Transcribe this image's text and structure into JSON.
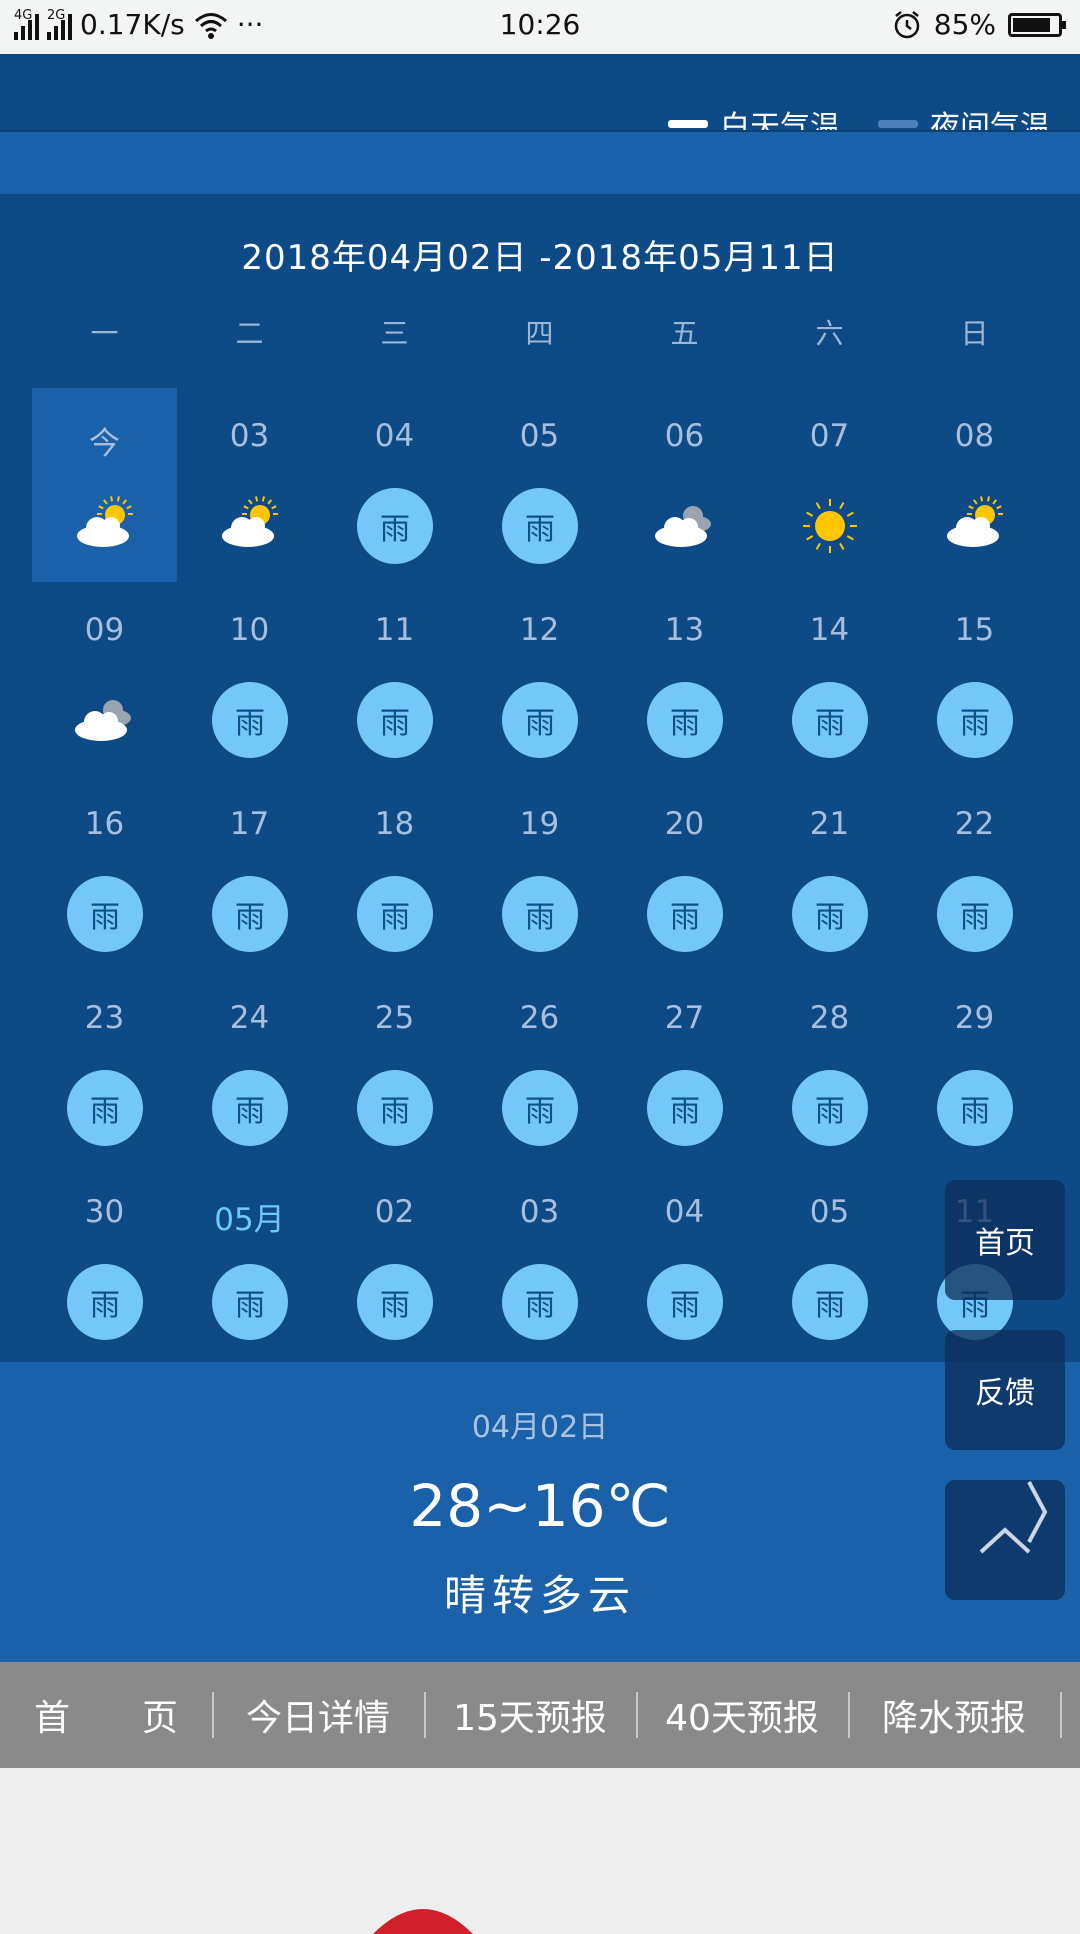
{
  "status_bar": {
    "net_4g": "4G",
    "net_2g": "2G",
    "speed": "0.17K/s",
    "more": "···",
    "time": "10:26",
    "battery": "85%",
    "battery_level": 0.85
  },
  "legend": {
    "day_label": "白天气温",
    "night_label": "夜间气温",
    "day_color": "#ffffff",
    "night_color": "#4d7fb8"
  },
  "calendar": {
    "range": "2018年04月02日 -2018年05月11日",
    "weekdays": [
      "一",
      "二",
      "三",
      "四",
      "五",
      "六",
      "日"
    ],
    "rain_label": "雨",
    "days": [
      {
        "label": "今",
        "icon": "partly-cloudy-icon"
      },
      {
        "label": "03",
        "icon": "partly-cloudy-icon"
      },
      {
        "label": "04",
        "icon": "rain-icon"
      },
      {
        "label": "05",
        "icon": "rain-icon"
      },
      {
        "label": "06",
        "icon": "cloudy-icon"
      },
      {
        "label": "07",
        "icon": "sunny-icon"
      },
      {
        "label": "08",
        "icon": "partly-cloudy-icon"
      },
      {
        "label": "09",
        "icon": "cloudy-icon"
      },
      {
        "label": "10",
        "icon": "rain-icon"
      },
      {
        "label": "11",
        "icon": "rain-icon"
      },
      {
        "label": "12",
        "icon": "rain-icon"
      },
      {
        "label": "13",
        "icon": "rain-icon"
      },
      {
        "label": "14",
        "icon": "rain-icon"
      },
      {
        "label": "15",
        "icon": "rain-icon"
      },
      {
        "label": "16",
        "icon": "rain-icon"
      },
      {
        "label": "17",
        "icon": "rain-icon"
      },
      {
        "label": "18",
        "icon": "rain-icon"
      },
      {
        "label": "19",
        "icon": "rain-icon"
      },
      {
        "label": "20",
        "icon": "rain-icon"
      },
      {
        "label": "21",
        "icon": "rain-icon"
      },
      {
        "label": "22",
        "icon": "rain-icon"
      },
      {
        "label": "23",
        "icon": "rain-icon"
      },
      {
        "label": "24",
        "icon": "rain-icon"
      },
      {
        "label": "25",
        "icon": "rain-icon"
      },
      {
        "label": "26",
        "icon": "rain-icon"
      },
      {
        "label": "27",
        "icon": "rain-icon"
      },
      {
        "label": "28",
        "icon": "rain-icon"
      },
      {
        "label": "29",
        "icon": "rain-icon"
      },
      {
        "label": "30",
        "icon": "rain-icon"
      },
      {
        "label": "05月",
        "icon": "rain-icon",
        "accent": true
      },
      {
        "label": "02",
        "icon": "rain-icon"
      },
      {
        "label": "03",
        "icon": "rain-icon"
      },
      {
        "label": "04",
        "icon": "rain-icon"
      },
      {
        "label": "05",
        "icon": "rain-icon"
      },
      {
        "label": "11",
        "icon": "rain-icon"
      }
    ]
  },
  "detail": {
    "date": "04月02日",
    "temp": "28~16℃",
    "condition": "晴转多云"
  },
  "float_buttons": {
    "home": "首页",
    "feedback": "反馈"
  },
  "bottom_nav": {
    "items": [
      "首　　页",
      "今日详情",
      "15天预报",
      "40天预报",
      "降水预报"
    ]
  },
  "colors": {
    "calendar_bg": "#0d4a86",
    "highlight_bg": "#1b61a9",
    "rain_circle": "#74c8f7",
    "sun": "#ffc600",
    "nav_bg": "#8a8a8a"
  }
}
